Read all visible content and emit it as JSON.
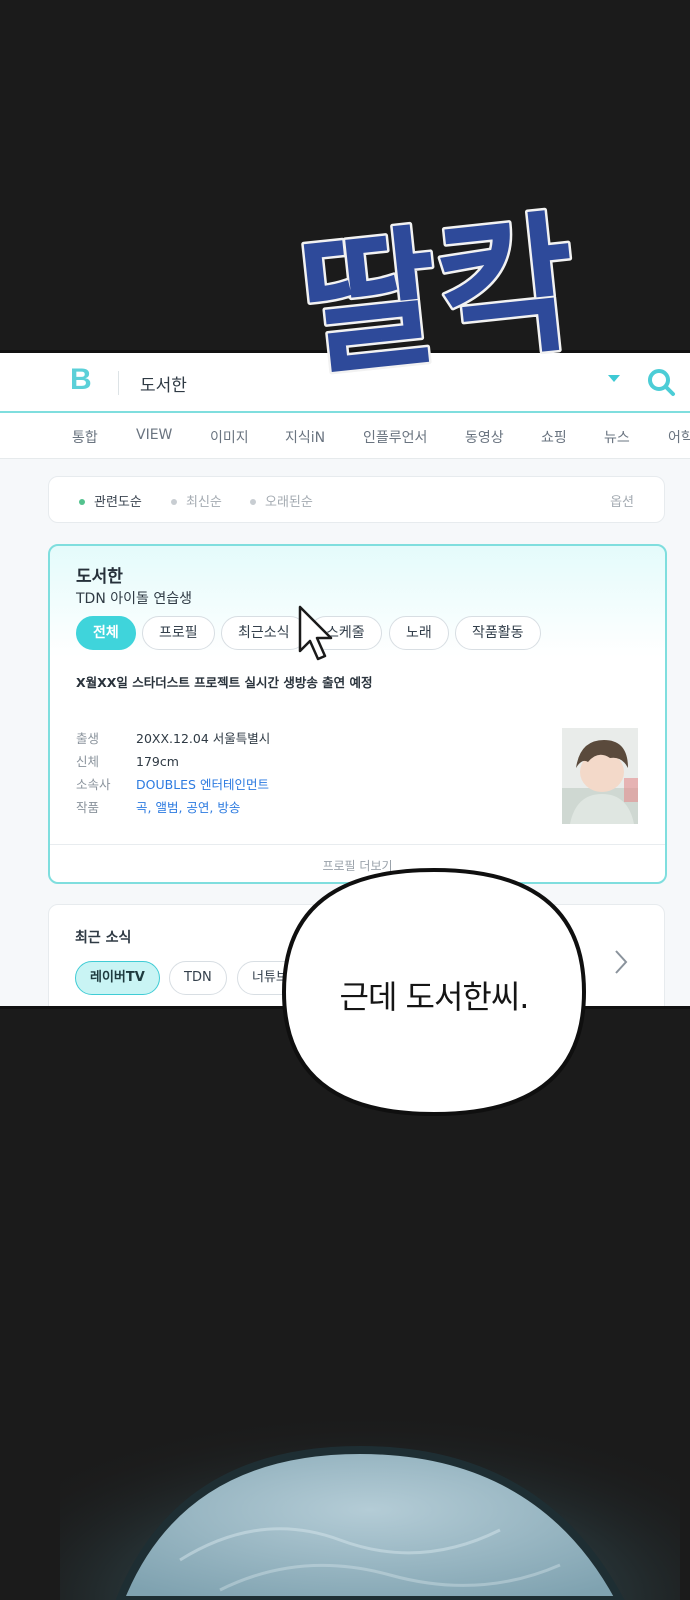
{
  "sfx": {
    "text": "딸칵"
  },
  "browser": {
    "logo": "B",
    "query": "도서한",
    "tabs": [
      "통합",
      "VIEW",
      "이미지",
      "지식iN",
      "인플루언서",
      "동영상",
      "쇼핑",
      "뉴스",
      "어학"
    ]
  },
  "sort": {
    "options": [
      "관련도순",
      "최신순",
      "오래된순"
    ],
    "active": "관련도순",
    "option_label": "옵션"
  },
  "profile": {
    "name": "도서한",
    "subtitle": "TDN 아이돌 연습생",
    "chips": [
      "전체",
      "프로필",
      "최근소식",
      "스케줄",
      "노래",
      "작품활동"
    ],
    "active_chip": "전체",
    "notice": "X월XX일 스타더스트 프로젝트 실시간 생방송 출연 예정",
    "info": [
      {
        "key": "출생",
        "value": "20XX.12.04 서울특별시",
        "link": false
      },
      {
        "key": "신체",
        "value": "179cm",
        "link": false
      },
      {
        "key": "소속사",
        "value": "DOUBLES 엔터테인먼트",
        "link": true
      },
      {
        "key": "작품",
        "value": "곡, 앨범, 공연, 방송",
        "link": true
      }
    ],
    "more_label": "프로필 더보기"
  },
  "news": {
    "title": "최근 소식",
    "chips": [
      "레이버TV",
      "TDN",
      "너튜브"
    ],
    "active_chip": "레이버TV"
  },
  "speech_bubble": {
    "text": "근데 도서한씨."
  },
  "colors": {
    "accent": "#3fd4db",
    "link": "#2d7be0",
    "background": "#1b1b1b",
    "sfx_fill": "#2e4a9a"
  }
}
